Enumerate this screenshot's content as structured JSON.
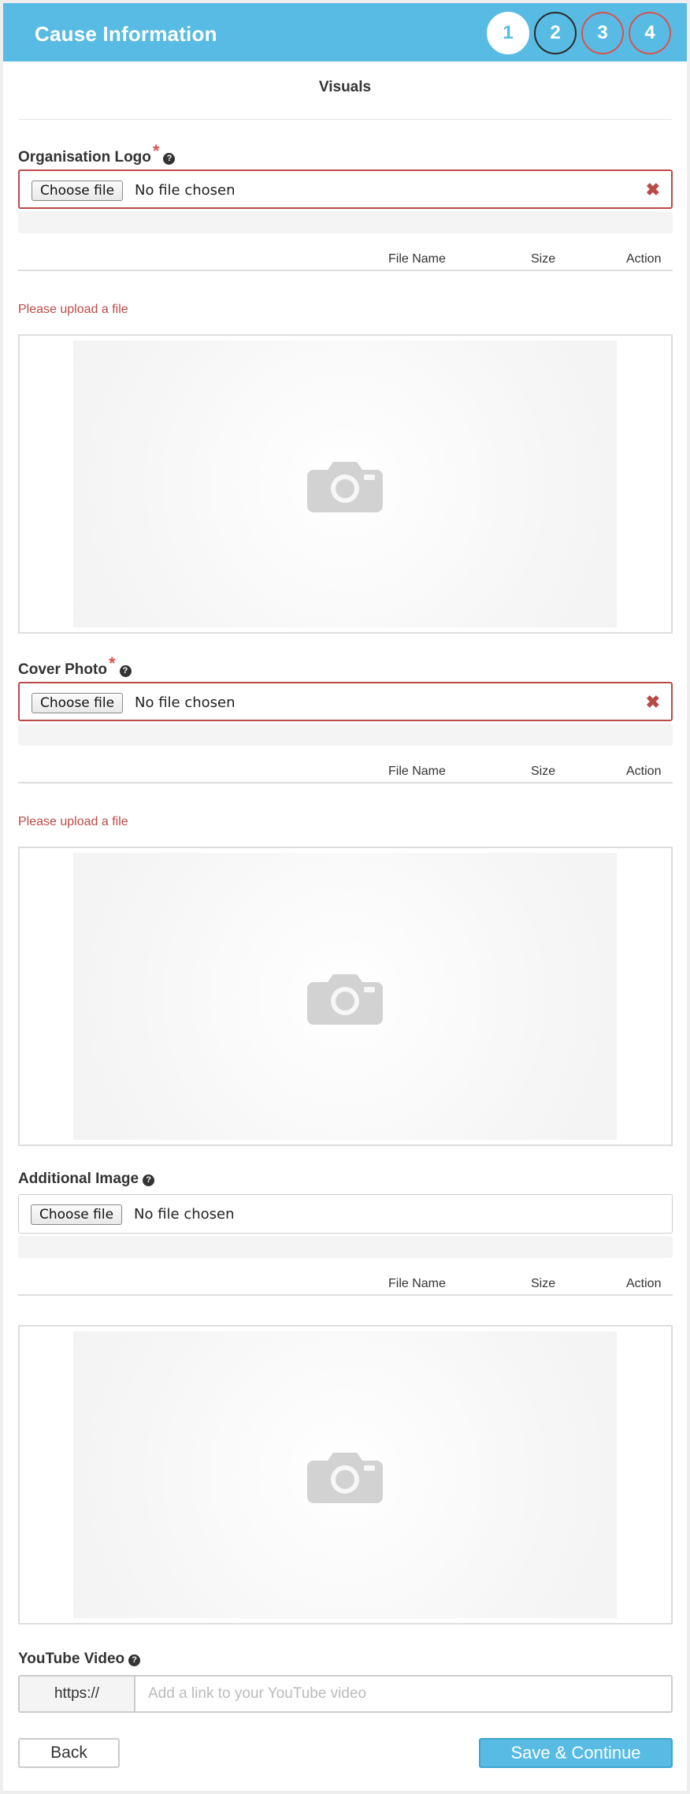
{
  "header": {
    "title": "Cause Information",
    "steps": [
      "1",
      "2",
      "3",
      "4"
    ]
  },
  "section": {
    "title": "Visuals"
  },
  "logo": {
    "label": "Organisation Logo",
    "required_mark": "*",
    "help_icon": "question-circle-icon",
    "choose_label": "Choose file",
    "file_status": "No file chosen",
    "columns": [
      "File Name",
      "Size",
      "Action"
    ],
    "error": "Please upload a file"
  },
  "cover": {
    "label": "Cover Photo",
    "required_mark": "*",
    "help_icon": "question-circle-icon",
    "choose_label": "Choose file",
    "file_status": "No file chosen",
    "columns": [
      "File Name",
      "Size",
      "Action"
    ],
    "error": "Please upload a file"
  },
  "additional": {
    "label": "Additional Image",
    "help_icon": "question-circle-icon",
    "choose_label": "Choose file",
    "file_status": "No file chosen",
    "columns": [
      "File Name",
      "Size",
      "Action"
    ]
  },
  "youtube": {
    "label": "YouTube Video",
    "help_icon": "question-circle-icon",
    "prefix": "https://",
    "placeholder": "Add a link to your YouTube video",
    "value": ""
  },
  "actions": {
    "back": "Back",
    "save": "Save & Continue"
  },
  "colors": {
    "brand": "#58bbe3",
    "error": "#b94a48",
    "required": "#d9534f"
  }
}
